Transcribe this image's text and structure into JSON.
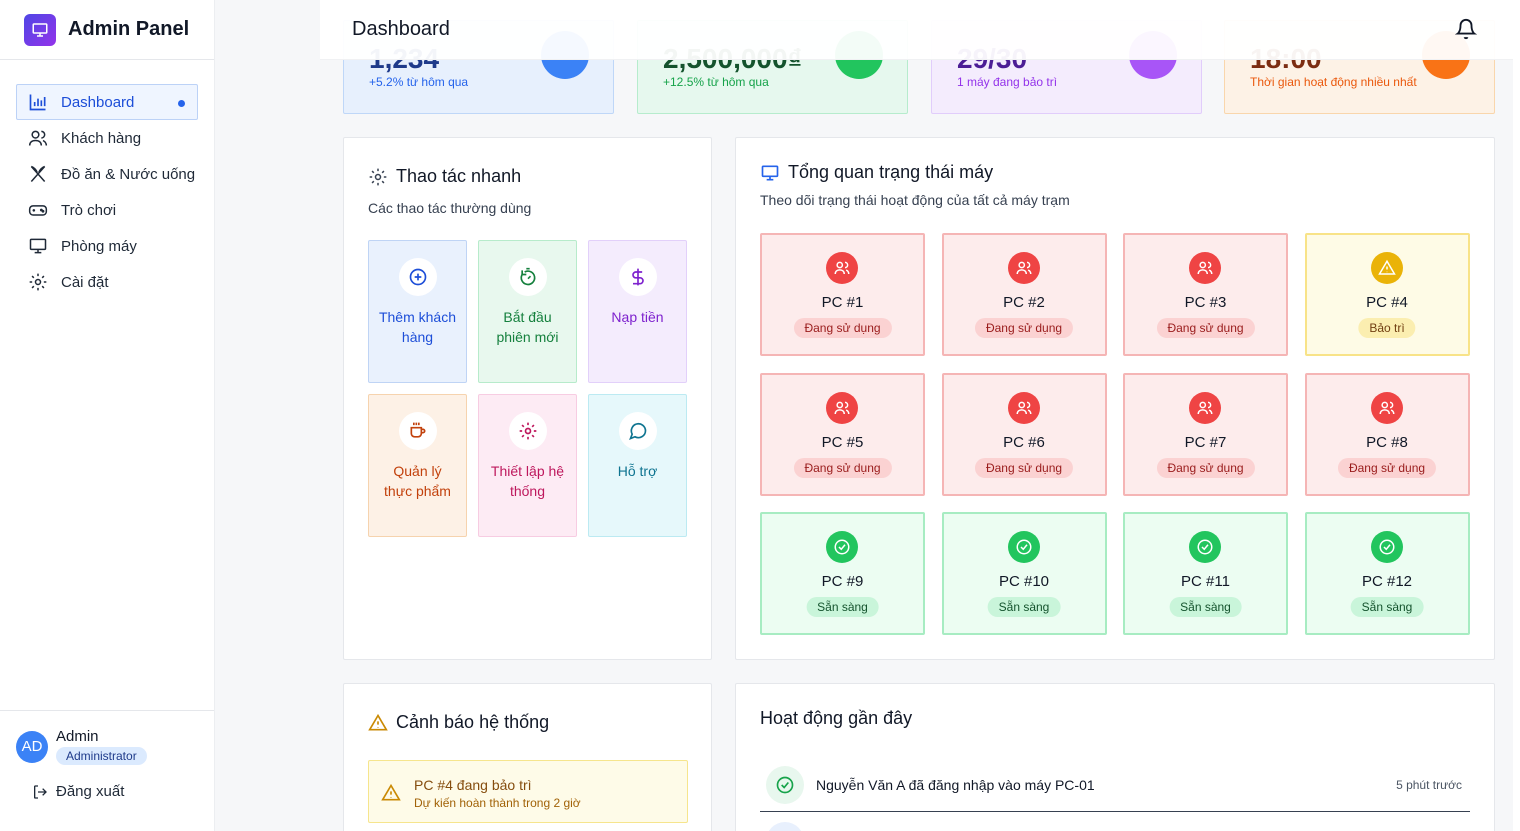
{
  "brand": {
    "title": "Admin Panel"
  },
  "nav": [
    {
      "label": "Dashboard",
      "icon": "bar-chart-icon",
      "active": true
    },
    {
      "label": "Khách hàng",
      "icon": "users-icon"
    },
    {
      "label": "Đồ ăn & Nước uống",
      "icon": "utensils-icon"
    },
    {
      "label": "Trò chơi",
      "icon": "gamepad-icon"
    },
    {
      "label": "Phòng máy",
      "icon": "monitor-icon"
    },
    {
      "label": "Cài đặt",
      "icon": "settings-icon"
    }
  ],
  "user": {
    "initials": "AD",
    "name": "Admin",
    "role": "Administrator"
  },
  "logout_label": "Đăng xuất",
  "header": {
    "title": "Dashboard"
  },
  "stats": [
    {
      "value": "1,234",
      "sub": "+5.2% từ hôm qua",
      "color": "#3b82f6"
    },
    {
      "value": "2,500,000₫",
      "sub": "+12.5% từ hôm qua",
      "color": "#22c55e"
    },
    {
      "value": "29/30",
      "sub": "1 máy đang bảo trì",
      "color": "#a855f7"
    },
    {
      "value": "18:00",
      "sub": "Thời gian hoạt động nhiều nhất",
      "color": "#f97316"
    }
  ],
  "quick_actions": {
    "title": "Thao tác nhanh",
    "desc": "Các thao tác thường dùng",
    "items": [
      {
        "label": "Thêm khách hàng",
        "icon": "plus-circle-icon"
      },
      {
        "label": "Bắt đầu phiên mới",
        "icon": "timer-icon"
      },
      {
        "label": "Nạp tiền",
        "icon": "dollar-icon"
      },
      {
        "label": "Quản lý thực phẩm",
        "icon": "coffee-icon"
      },
      {
        "label": "Thiết lập hệ thống",
        "icon": "settings-icon"
      },
      {
        "label": "Hỗ trợ",
        "icon": "message-circle-icon"
      }
    ]
  },
  "pc_status": {
    "title": "Tổng quan trạng thái máy",
    "desc": "Theo dõi trạng thái hoạt động của tất cả máy trạm",
    "pcs": [
      {
        "name": "PC #1",
        "status": "Đang sử dụng",
        "state": "busy"
      },
      {
        "name": "PC #2",
        "status": "Đang sử dụng",
        "state": "busy"
      },
      {
        "name": "PC #3",
        "status": "Đang sử dụng",
        "state": "busy"
      },
      {
        "name": "PC #4",
        "status": "Bảo trì",
        "state": "maint"
      },
      {
        "name": "PC #5",
        "status": "Đang sử dụng",
        "state": "busy"
      },
      {
        "name": "PC #6",
        "status": "Đang sử dụng",
        "state": "busy"
      },
      {
        "name": "PC #7",
        "status": "Đang sử dụng",
        "state": "busy"
      },
      {
        "name": "PC #8",
        "status": "Đang sử dụng",
        "state": "busy"
      },
      {
        "name": "PC #9",
        "status": "Sẵn sàng",
        "state": "ready"
      },
      {
        "name": "PC #10",
        "status": "Sẵn sàng",
        "state": "ready"
      },
      {
        "name": "PC #11",
        "status": "Sẵn sàng",
        "state": "ready"
      },
      {
        "name": "PC #12",
        "status": "Sẵn sàng",
        "state": "ready"
      }
    ]
  },
  "alerts": {
    "title": "Cảnh báo hệ thống",
    "items": [
      {
        "title": "PC #4 đang bảo trì",
        "sub": "Dự kiến hoàn thành trong 2 giờ"
      }
    ]
  },
  "activity": {
    "title": "Hoạt động gần đây",
    "items": [
      {
        "text": "Nguyễn Văn A đã đăng nhập vào máy PC-01",
        "time": "5 phút trước"
      }
    ]
  }
}
